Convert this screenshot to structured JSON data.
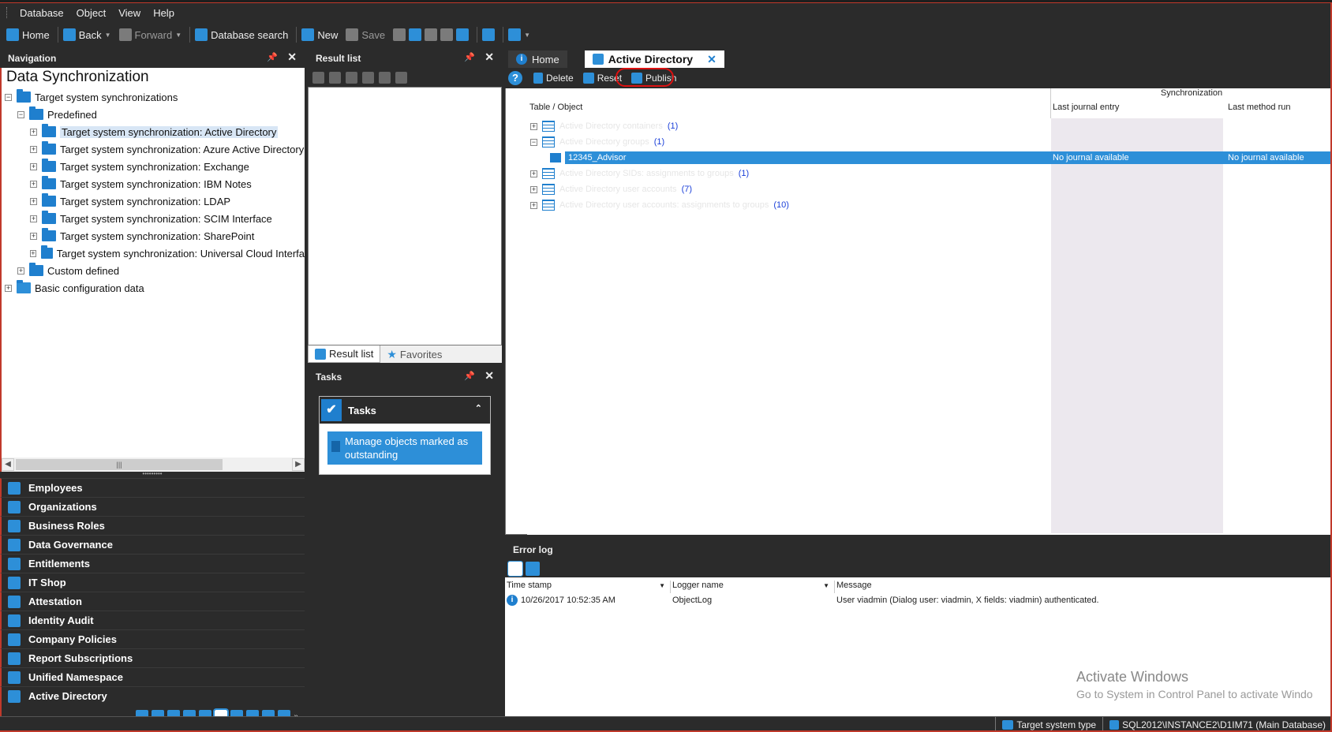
{
  "menu": [
    "Database",
    "Object",
    "View",
    "Help"
  ],
  "toolbar": {
    "home": "Home",
    "back": "Back",
    "forward": "Forward",
    "search": "Database search",
    "new": "New",
    "save": "Save"
  },
  "navigation": {
    "header": "Navigation",
    "title": "Data Synchronization",
    "tree": {
      "root": "Target system synchronizations",
      "predefined": "Predefined",
      "items": [
        "Target system synchronization: Active Directory",
        "Target system synchronization: Azure Active Directory",
        "Target system synchronization: Exchange",
        "Target system synchronization: IBM Notes",
        "Target system synchronization: LDAP",
        "Target system synchronization: SCIM Interface",
        "Target system synchronization: SharePoint",
        "Target system synchronization: Universal Cloud Interfa"
      ],
      "custom": "Custom defined",
      "basic": "Basic configuration data"
    },
    "buttons": [
      "Employees",
      "Organizations",
      "Business Roles",
      "Data Governance",
      "Entitlements",
      "IT Shop",
      "Attestation",
      "Identity Audit",
      "Company Policies",
      "Report Subscriptions",
      "Unified Namespace",
      "Active Directory"
    ]
  },
  "result_list": {
    "header": "Result list",
    "tab_result": "Result list",
    "tab_favorites": "Favorites"
  },
  "tasks": {
    "header": "Tasks",
    "title": "Tasks",
    "item": "Manage objects marked as outstanding"
  },
  "document": {
    "tab_home": "Home",
    "tab_active": "Active Directory",
    "delete": "Delete",
    "reset": "Reset",
    "publish": "Publish",
    "sync_header": "Synchronization",
    "col_table": "Table / Object",
    "col_journal": "Last journal entry",
    "col_method": "Last method run",
    "rows": [
      {
        "label": "Active Directory containers",
        "count": "(1)"
      },
      {
        "label": "Active Directory groups",
        "count": "(1)"
      },
      {
        "label": "Active Directory SIDs: assignments to groups",
        "count": "(1)"
      },
      {
        "label": "Active Directory user accounts",
        "count": "(7)"
      },
      {
        "label": "Active Directory user accounts: assignments to groups",
        "count": "(10)"
      }
    ],
    "child": {
      "label": "12345_Advisor",
      "journal": "No journal available",
      "method": "No journal available"
    }
  },
  "error_log": {
    "header": "Error log",
    "col_time": "Time stamp",
    "col_logger": "Logger name",
    "col_message": "Message",
    "row": {
      "time": "10/26/2017 10:52:35 AM",
      "logger": "ObjectLog",
      "message": "User viadmin (Dialog user: viadmin, X fields: viadmin) authenticated."
    }
  },
  "watermark": {
    "line1": "Activate Windows",
    "line2": "Go to System in Control Panel to activate Windo"
  },
  "status": {
    "target": "Target system type",
    "db": "SQL2012\\INSTANCE2\\D1IM71 (Main Database)"
  }
}
